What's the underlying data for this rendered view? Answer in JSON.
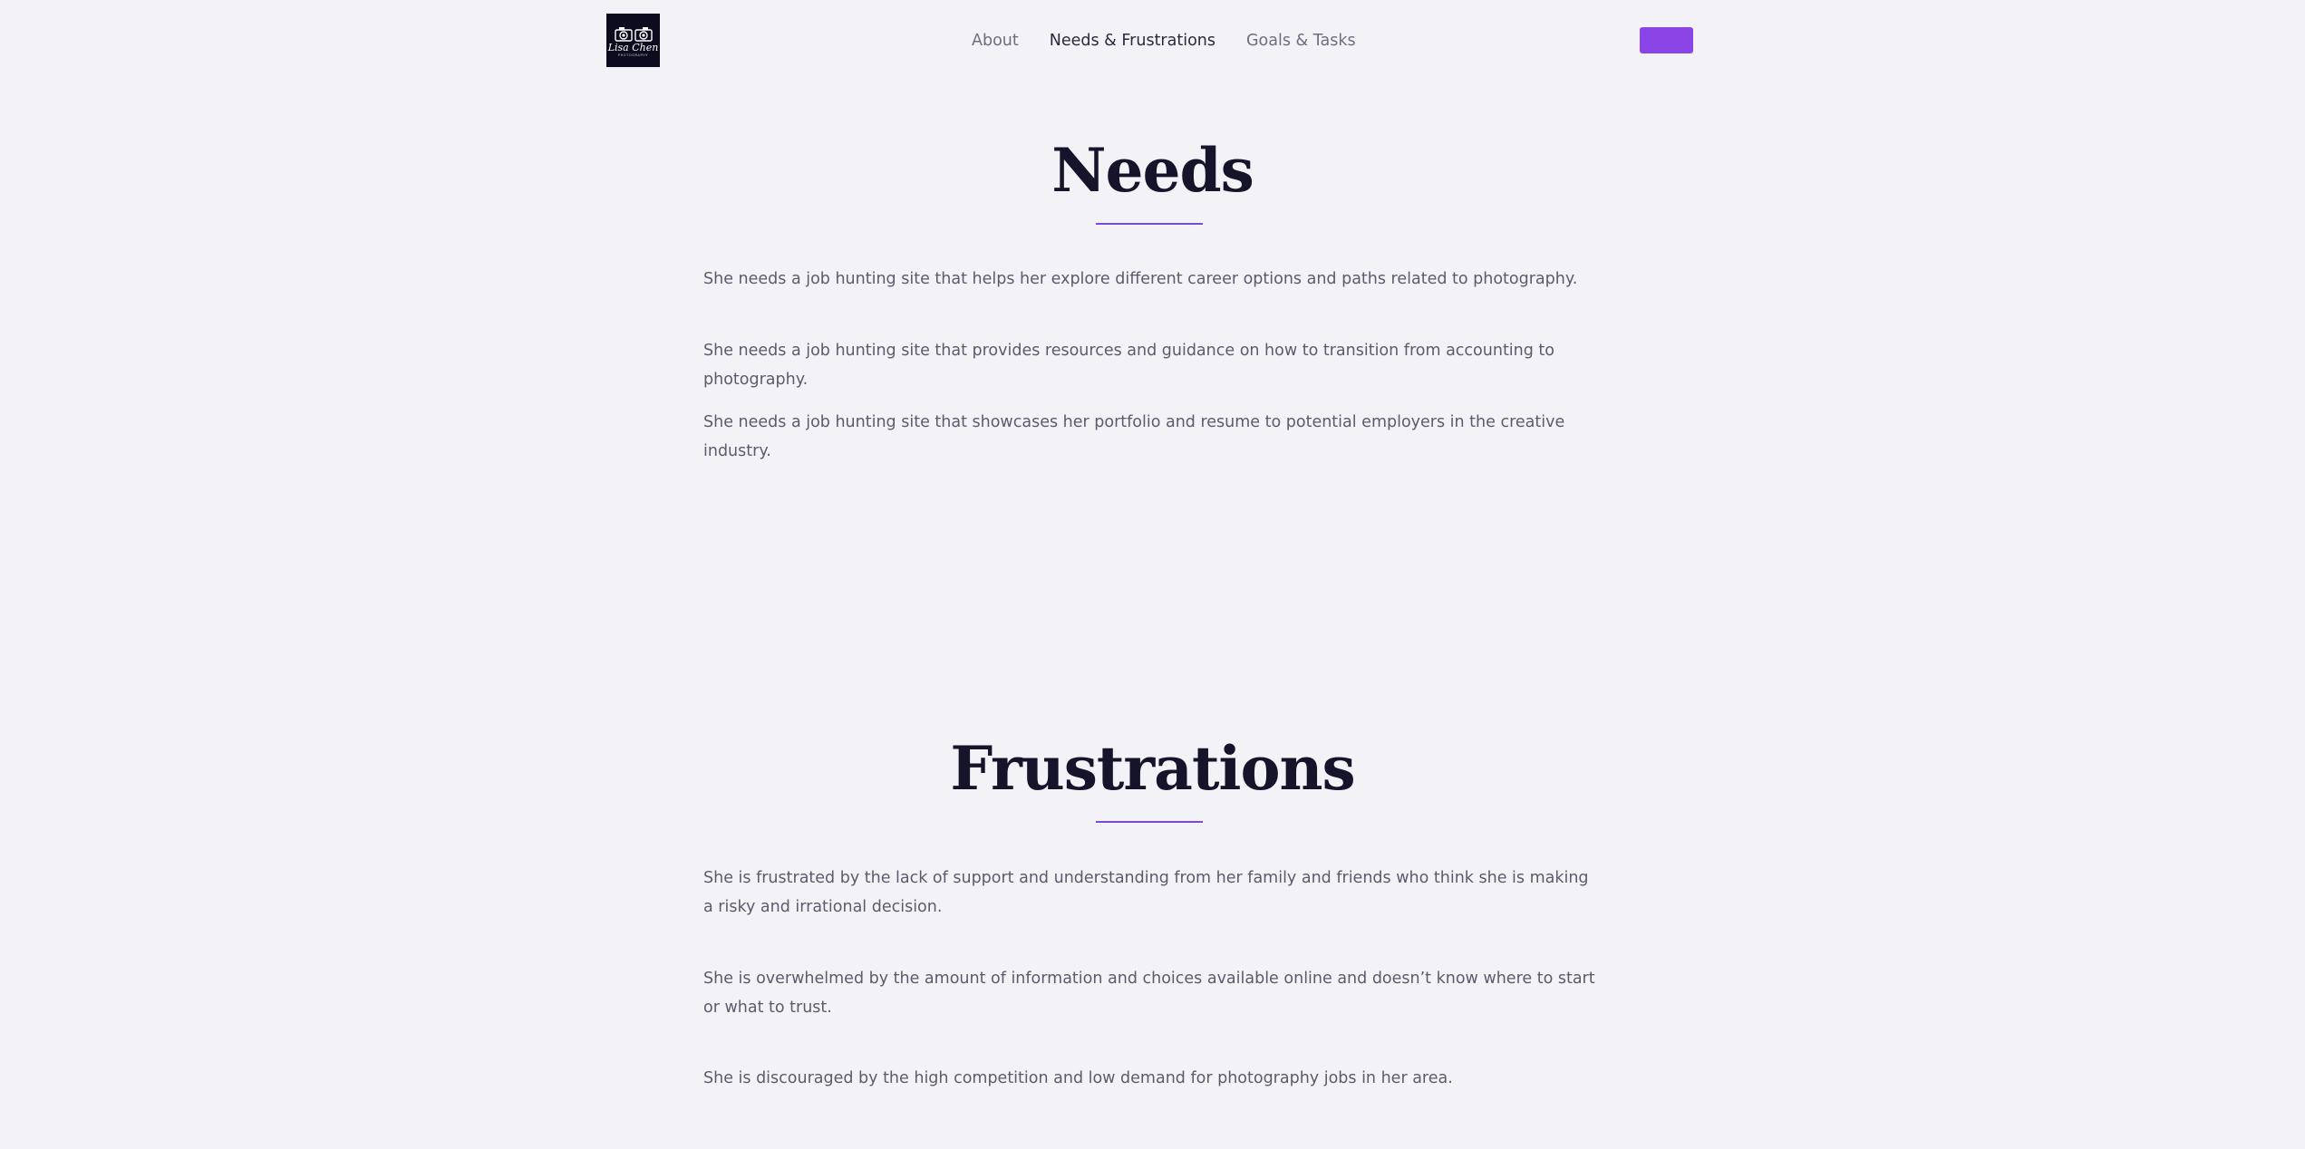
{
  "header": {
    "logo": {
      "name": "Lisa Chen",
      "subtitle": "PHOTOGRAPHY"
    },
    "nav": [
      {
        "label": "About"
      },
      {
        "label": "Needs & Frustrations"
      },
      {
        "label": "Goals & Tasks"
      }
    ],
    "active_nav_index": 1,
    "cta_label": ""
  },
  "needs": {
    "title": "Needs",
    "items": [
      "She needs a job hunting site that helps her explore different career options and paths related to photography.",
      "She needs a job hunting site that provides resources and guidance on how to transition from accounting to photography.",
      "She needs a job hunting site that showcases her portfolio and resume to potential employers in the creative industry."
    ]
  },
  "frustrations": {
    "title": "Frustrations",
    "items": [
      "She is frustrated by the lack of support and understanding from her family and friends who think she is making a risky and irrational decision.",
      "She is overwhelmed by the amount of information and choices available online and doesn’t know where to start or what to trust.",
      "She is discouraged by the high competition and low demand for photography jobs in her area."
    ]
  },
  "colors": {
    "background": "#f3f2f7",
    "accent": "#8b44e6",
    "underline": "#7a4ad3",
    "heading": "#15142a",
    "body_text": "#5c5b6c",
    "logo_bg": "#0d0c1f"
  },
  "icons": {
    "logo": "camera-icon"
  }
}
